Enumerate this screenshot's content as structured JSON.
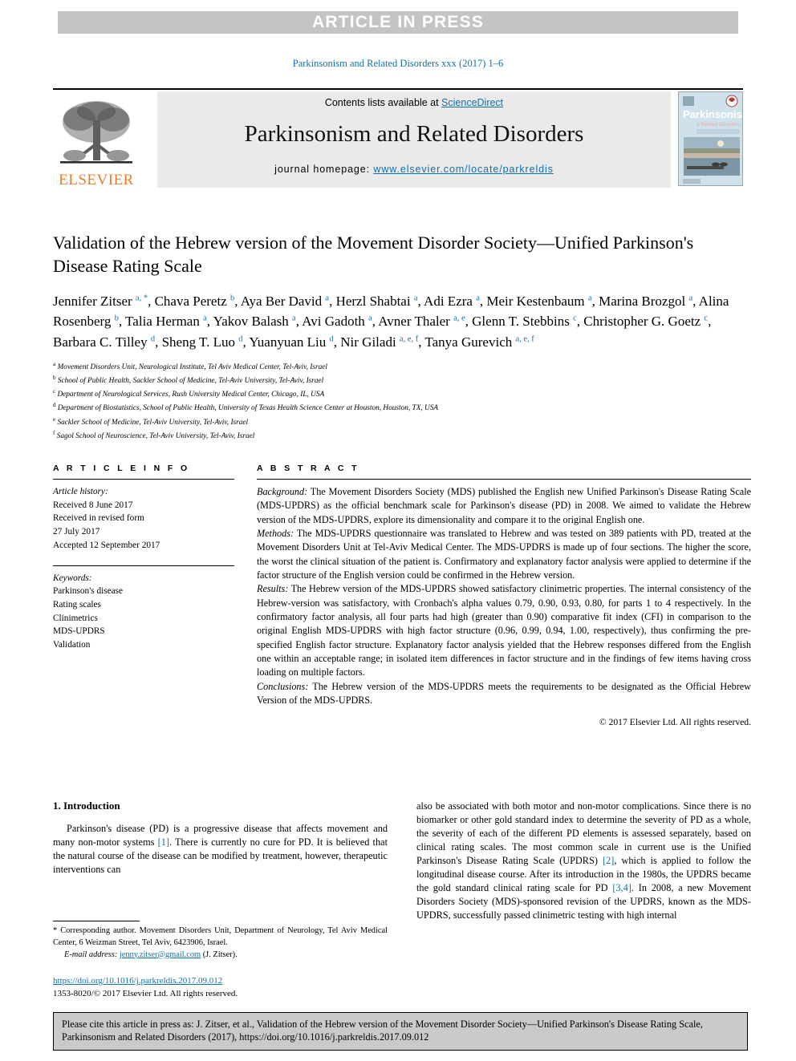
{
  "banner": {
    "text": "ARTICLE IN PRESS"
  },
  "running_head": "Parkinsonism and Related Disorders xxx (2017) 1–6",
  "masthead": {
    "contents_prefix": "Contents lists available at ",
    "contents_link": "ScienceDirect",
    "journal_title": "Parkinsonism and Related Disorders",
    "homepage_prefix": "journal homepage: ",
    "homepage_url": "www.elsevier.com/locate/parkreldis",
    "publisher": "ELSEVIER",
    "cover_title": "Parkinsonism",
    "cover_subtitle": "& Related Disorders"
  },
  "article": {
    "title": "Validation of the Hebrew version of the Movement Disorder Society—Unified Parkinson's Disease Rating Scale",
    "authors_html": "Jennifer Zitser <sup>a, *</sup>, Chava Peretz <sup>b</sup>, Aya Ber David <sup>a</sup>, Herzl Shabtai <sup>a</sup>, Adi Ezra <sup>a</sup>, Meir Kestenbaum <sup>a</sup>, Marina Brozgol <sup>a</sup>, Alina Rosenberg <sup>b</sup>, Talia Herman <sup>a</sup>, Yakov Balash <sup>a</sup>, Avi Gadoth <sup>a</sup>, Avner Thaler <sup>a, e</sup>, Glenn T. Stebbins <sup>c</sup>, Christopher G. Goetz <sup>c</sup>, Barbara C. Tilley <sup>d</sup>, Sheng T. Luo <sup>d</sup>, Yuanyuan Liu <sup>d</sup>, Nir Giladi <sup>a, e, f</sup>, Tanya Gurevich <sup>a, e, f</sup>",
    "affiliations": [
      {
        "mark": "a",
        "text": "Movement Disorders Unit, Neurological Institute, Tel Aviv Medical Center, Tel-Aviv, Israel"
      },
      {
        "mark": "b",
        "text": "School of Public Health, Sackler School of Medicine, Tel-Aviv University, Tel-Aviv, Israel"
      },
      {
        "mark": "c",
        "text": "Department of Neurological Services, Rush University Medical Center, Chicago, IL, USA"
      },
      {
        "mark": "d",
        "text": "Department of Biostatistics, School of Public Health, University of Texas Health Science Center at Houston, Houston, TX, USA"
      },
      {
        "mark": "e",
        "text": "Sackler School of Medicine, Tel-Aviv University, Tel-Aviv, Israel"
      },
      {
        "mark": "f",
        "text": "Sagol School of Neuroscience, Tel-Aviv University, Tel-Aviv, Israel"
      }
    ]
  },
  "article_info": {
    "heading": "A R T I C L E   I N F O",
    "history_label": "Article history:",
    "history_lines": [
      "Received 8 June 2017",
      "Received in revised form",
      "27 July 2017",
      "Accepted 12 September 2017"
    ],
    "keywords_label": "Keywords:",
    "keywords": [
      "Parkinson's disease",
      "Rating scales",
      "Clinimetrics",
      "MDS-UPDRS",
      "Validation"
    ]
  },
  "abstract": {
    "heading": "A B S T R A C T",
    "sections": [
      {
        "label": "Background:",
        "text": " The Movement Disorders Society (MDS) published the English new Unified Parkinson's Disease Rating Scale (MDS-UPDRS) as the official benchmark scale for Parkinson's disease (PD) in 2008. We aimed to validate the Hebrew version of the MDS-UPDRS, explore its dimensionality and compare it to the original English one."
      },
      {
        "label": "Methods:",
        "text": " The MDS-UPDRS questionnaire was translated to Hebrew and was tested on 389 patients with PD, treated at the Movement Disorders Unit at Tel-Aviv Medical Center. The MDS-UPDRS is made up of four sections. The higher the score, the worst the clinical situation of the patient is. Confirmatory and explanatory factor analysis were applied to determine if the factor structure of the English version could be confirmed in the Hebrew version."
      },
      {
        "label": "Results:",
        "text": " The Hebrew version of the MDS-UPDRS showed satisfactory clinimetric properties. The internal consistency of the Hebrew-version was satisfactory, with Cronbach's alpha values 0.79, 0.90, 0.93, 0.80, for parts 1 to 4 respectively. In the confirmatory factor analysis, all four parts had high (greater than 0.90) comparative fit index (CFI) in comparison to the original English MDS-UPDRS with high factor structure (0.96, 0.99, 0.94, 1.00, respectively), thus confirming the pre-specified English factor structure. Explanatory factor analysis yielded that the Hebrew responses differed from the English one within an acceptable range; in isolated item differences in factor structure and in the findings of few items having cross loading on multiple factors."
      },
      {
        "label": "Conclusions:",
        "text": " The Hebrew version of the MDS-UPDRS meets the requirements to be designated as the Official Hebrew Version of the MDS-UPDRS."
      }
    ],
    "copyright": "© 2017 Elsevier Ltd. All rights reserved."
  },
  "intro": {
    "heading": "1. Introduction",
    "left_html": "Parkinson's disease (PD) is a progressive disease that affects movement and many non-motor systems <span class=\"ref\">[1]</span>. There is currently no cure for PD. It is believed that the natural course of the disease can be modified by treatment, however, therapeutic interventions can",
    "right_html": "also be associated with both motor and non-motor complications. Since there is no biomarker or other gold standard index to determine the severity of PD as a whole, the severity of each of the different PD elements is assessed separately, based on clinical rating scales. The most common scale in current use is the Unified Parkinson's Disease Rating Scale (UPDRS) <span class=\"ref\">[2]</span>, which is applied to follow the longitudinal disease course. After its introduction in the 1980s, the UPDRS became the gold standard clinical rating scale for PD <span class=\"ref\">[3,4]</span>. In 2008, a new Movement Disorders Society (MDS)-sponsored revision of the UPDRS, known as the MDS-UPDRS, successfully passed clinimetric testing with high internal"
  },
  "footnote": {
    "corresponding_html": "* <span class=\"lbl\"></span>Corresponding author. Movement Disorders Unit, Department of Neurology, Tel Aviv Medical Center, 6 Weizman Street, Tel Aviv, 6423906, Israel.",
    "email_label": "E-mail address:",
    "email": "jenny.zitser@gmail.com",
    "email_suffix": " (J. Zitser).",
    "doi": "https://doi.org/10.1016/j.parkreldis.2017.09.012",
    "issn_line": "1353-8020/© 2017 Elsevier Ltd. All rights reserved."
  },
  "cite_box": {
    "text": "Please cite this article in press as: J. Zitser, et al., Validation of the Hebrew version of the Movement Disorder Society—Unified Parkinson's Disease Rating Scale, Parkinsonism and Related Disorders (2017), https://doi.org/10.1016/j.parkreldis.2017.09.012"
  },
  "colors": {
    "link": "#1470a8",
    "banner_bg": "#c3c4c6",
    "masthead_bg": "#eaeaea",
    "elsevier_orange": "#ec7c28",
    "cite_bg": "#c9cacb"
  }
}
